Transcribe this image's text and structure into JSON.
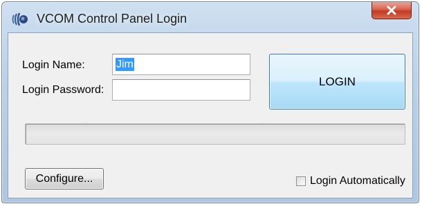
{
  "window": {
    "title": "VCOM Control Panel Login",
    "icon": "vcom-app-icon",
    "close_icon": "close-x-icon"
  },
  "form": {
    "login_name_label": "Login Name:",
    "login_name_value": "Jim",
    "login_password_label": "Login Password:",
    "login_password_value": ""
  },
  "buttons": {
    "login": "LOGIN",
    "configure": "Configure..."
  },
  "status": {
    "progress": 0
  },
  "options": {
    "login_automatically_label": "Login Automatically",
    "login_automatically_checked": false
  },
  "colors": {
    "selection": "#3399ff",
    "close_button": "#c33a22",
    "login_button": "#bee6fd"
  }
}
